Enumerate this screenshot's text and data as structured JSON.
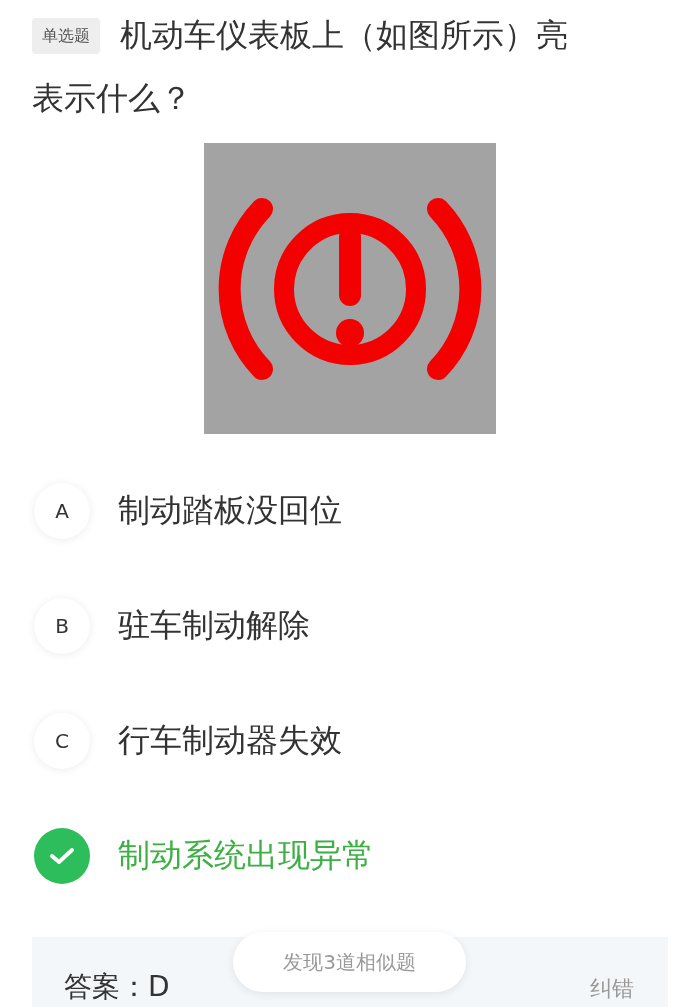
{
  "question": {
    "type_tag": "单选题",
    "text_lines": [
      "机动车仪表板上（如图所示）亮",
      "表示什么？"
    ]
  },
  "figure": {
    "kind": "warning-light"
  },
  "options": [
    {
      "letter": "A",
      "text": "制动踏板没回位",
      "selected": false
    },
    {
      "letter": "B",
      "text": "驻车制动解除",
      "selected": false
    },
    {
      "letter": "C",
      "text": "行车制动器失效",
      "selected": false
    },
    {
      "text": "制动系统出现异常",
      "selected": true
    }
  ],
  "answer": {
    "text": "答案：D",
    "report_link": "纠错"
  },
  "similar_toast": "发现3道相似题"
}
